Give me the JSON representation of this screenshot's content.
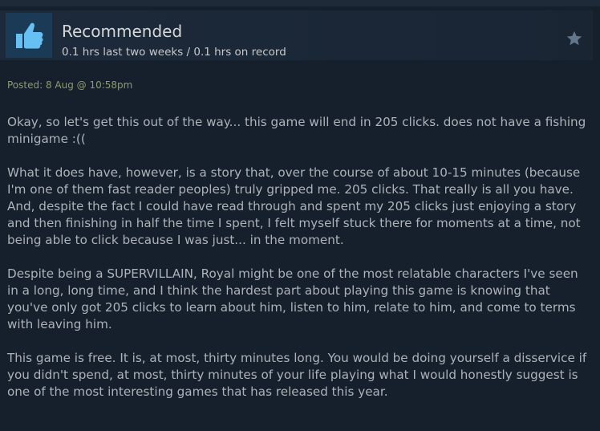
{
  "review": {
    "verdict": "Recommended",
    "playtime": "0.1 hrs last two weeks / 0.1 hrs on record",
    "posted": "Posted: 8 Aug @ 10:58pm",
    "icons": {
      "thumb": "thumbs-up-icon",
      "award": "star-icon"
    },
    "paragraphs": [
      "Okay, so let's get this out of the way... this game will end in 205 clicks. does not have a fishing minigame :((",
      "What it does have, however, is a story that, over the course of about 10-15 minutes (because I'm one of them fast reader peoples) truly gripped me. 205 clicks. That really is all you have. And, despite the fact I could have read through and spent my 205 clicks just enjoying a story and then finishing in half the time I spent, I felt myself stuck there for moments at a time, not being able to click because I was just... in the moment.",
      "Despite being a SUPERVILLAIN, Royal might be one of the most relatable characters I've seen in a long, long time, and I think the hardest part about playing this game is knowing that you've only got 205 clicks to learn about him, listen to him, relate to him, and come to terms with leaving him.",
      "This game is free. It is, at most, thirty minutes long. You would be doing yourself a disservice if you didn't spend, at most, thirty minutes of your life playing what I would honestly suggest is one of the most interesting games that has released this year."
    ]
  },
  "colors": {
    "background": "#16202d",
    "header": "#1c2a3b",
    "thumb_bg": "#1a3a55",
    "thumb": "#66c0f4",
    "posted": "#8e9a6b",
    "text": "#acb2b8"
  }
}
